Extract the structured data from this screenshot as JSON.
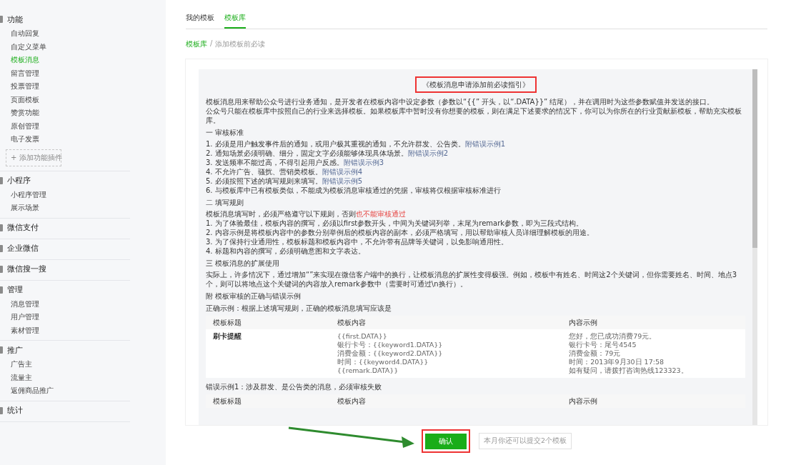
{
  "sidebar": {
    "groups": [
      {
        "title": "功能",
        "items": [
          {
            "label": "自动回复",
            "selected": false
          },
          {
            "label": "自定义菜单",
            "selected": false
          },
          {
            "label": "模板消息",
            "selected": true
          },
          {
            "label": "留言管理",
            "selected": false
          },
          {
            "label": "投票管理",
            "selected": false
          },
          {
            "label": "页面模板",
            "selected": false
          },
          {
            "label": "赞赏功能",
            "selected": false
          },
          {
            "label": "原创管理",
            "selected": false
          },
          {
            "label": "电子发票",
            "selected": false
          }
        ],
        "add_button": {
          "icon": "+",
          "label": "添加功能插件"
        }
      },
      {
        "title": "小程序",
        "items": [
          {
            "label": "小程序管理",
            "selected": false
          },
          {
            "label": "展示场景",
            "selected": false
          }
        ]
      },
      {
        "title": "微信支付"
      },
      {
        "title": "企业微信"
      },
      {
        "title": "微信搜一搜"
      },
      {
        "title": "管理",
        "items": [
          {
            "label": "消息管理",
            "selected": false
          },
          {
            "label": "用户管理",
            "selected": false
          },
          {
            "label": "素材管理",
            "selected": false
          }
        ]
      },
      {
        "title": "推广",
        "items": [
          {
            "label": "广告主",
            "selected": false
          },
          {
            "label": "流量主",
            "selected": false
          },
          {
            "label": "返佣商品推广",
            "selected": false
          }
        ]
      },
      {
        "title": "统计"
      }
    ]
  },
  "tabs": [
    {
      "label": "我的模板",
      "selected": false
    },
    {
      "label": "模板库",
      "selected": true
    }
  ],
  "breadcrumb": {
    "parent": "模板库",
    "separator": "/",
    "current": "添加模板前必读"
  },
  "guide": {
    "title": "《模板消息申请添加前必读指引》",
    "intro": [
      "模板消息用来帮助公众号进行业务通知，是开发者在模板内容中设定参数（参数以“{{” 开头，以“.DATA}}” 结尾），并在调用时为这些参数赋值并发送的接口。",
      "公众号只能在模板库中按照自己的行业来选择模板。如果模板库中暂时没有你想要的模板，则在满足下述要求的情况下，你可以为你所在的行业贡献新模板，帮助充实模板库。"
    ],
    "sections": [
      {
        "heading": "一  审核标准",
        "items": [
          {
            "text": "1. 必须是用户触发事件后的通知，或用户极其重视的通知，不允许群发、公告类。",
            "link": "附错误示例1"
          },
          {
            "text": "2. 通知场景必须明确、细分，固定文字必须能够体现具体场景。",
            "link": "附错误示例2"
          },
          {
            "text": "3. 发送频率不能过高，不得引起用户反感。",
            "link": "附错误示例3"
          },
          {
            "text": "4. 不允许广告、骚扰、营销类模板。",
            "link": "附错误示例4"
          },
          {
            "text": "5. 必须按照下述的填写规则来填写。",
            "link": "附错误示例5"
          },
          {
            "text": "6. 与模板库中已有模板类似，不能成为模板消息审核通过的凭据，审核将仅根据审核标准进行"
          }
        ]
      },
      {
        "heading": "二  填写规则",
        "lead": {
          "text": "模板消息填写时，必须严格遵守以下规则，否则",
          "warning": "也不能审核通过"
        },
        "items": [
          {
            "text": "1. 为了体验最佳，模板内容的撰写，必须以first参数开头，中间为关键词列举，末尾为remark参数，即为三段式结构。"
          },
          {
            "text": "2. 内容示例是将模板内容中的参数分别举例后的模板内容的副本，必须严格填写，用以帮助审核人员详细理解模板的用途。"
          },
          {
            "text": "3. 为了保持行业通用性，模板标题和模板内容中，不允许带有品牌等关键词，以免影响通用性。"
          },
          {
            "text": "4. 标题和内容的撰写，必须明确意图和文字表达。"
          }
        ]
      },
      {
        "heading": "三  模板消息的扩展使用",
        "paragraph": "实际上，许多情况下，通过增加“”来实现在微信客户端中的换行，让模板消息的扩展性变得极强。例如，模板中有姓名、时间这2个关键词，但你需要姓名、时间、地点3个，则可以将地点这个关键词的内容放入remark参数中（需要时可通过\\n换行）。"
      },
      {
        "heading": "附  模板审核的正确与错误示例"
      }
    ],
    "examples": [
      {
        "caption": "正确示例：根据上述填写规则，正确的模板消息填写应该是",
        "columns": [
          "模板标题",
          "模板内容",
          "内容示例"
        ],
        "rows": [
          [
            [
              "刷卡提醒"
            ],
            [
              "{{first.DATA}}",
              "银行卡号：{{keyword1.DATA}}",
              "消费金额：{{keyword2.DATA}}",
              "时间：{{keyword4.DATA}}",
              "{{remark.DATA}}"
            ],
            [
              "您好，您已成功消费79元。",
              "银行卡号：尾号4545",
              "消费金额：79元",
              "时间：2013年9月30日 17:58",
              "如有疑问，请拨打咨询热线123323。"
            ]
          ]
        ]
      },
      {
        "caption": "错误示例1：涉及群发、是公告类的消息，必须审核失败",
        "columns": [
          "模板标题",
          "模板内容",
          "内容示例"
        ]
      }
    ]
  },
  "footer": {
    "confirm_button": "确认",
    "quota_note": "本月你还可以提交2个模板"
  }
}
